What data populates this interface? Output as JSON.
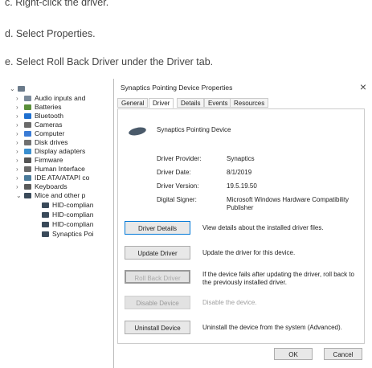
{
  "steps": [
    "c. Right-click the driver.",
    "d. Select Properties.",
    "e. Select Roll Back Driver under the Driver tab."
  ],
  "device_tree": {
    "items": [
      {
        "label": "Audio inputs and",
        "icon": "speaker-icon",
        "color": "#7a8a9a"
      },
      {
        "label": "Batteries",
        "icon": "battery-icon",
        "color": "#5a8f3a"
      },
      {
        "label": "Bluetooth",
        "icon": "bluetooth-icon",
        "color": "#1e6fd0"
      },
      {
        "label": "Cameras",
        "icon": "camera-icon",
        "color": "#6a6a6a"
      },
      {
        "label": "Computer",
        "icon": "computer-icon",
        "color": "#3a7bd5"
      },
      {
        "label": "Disk drives",
        "icon": "disk-icon",
        "color": "#707070"
      },
      {
        "label": "Display adapters",
        "icon": "display-icon",
        "color": "#3a8fcf"
      },
      {
        "label": "Firmware",
        "icon": "firmware-icon",
        "color": "#555555"
      },
      {
        "label": "Human Interface",
        "icon": "hid-icon",
        "color": "#6a6a6a"
      },
      {
        "label": "IDE ATA/ATAPI co",
        "icon": "ide-icon",
        "color": "#4a7a9a"
      },
      {
        "label": "Keyboards",
        "icon": "keyboard-icon",
        "color": "#5a5a5a"
      },
      {
        "label": "Mice and other p",
        "icon": "mouse-icon",
        "color": "#3a4a5a"
      },
      {
        "label": "HID-complian",
        "icon": "mouse-icon",
        "color": "#3a4a5a"
      },
      {
        "label": "HID-complian",
        "icon": "mouse-icon",
        "color": "#3a4a5a"
      },
      {
        "label": "HID-complian",
        "icon": "mouse-icon",
        "color": "#3a4a5a"
      },
      {
        "label": "Synaptics Poi",
        "icon": "mouse-icon",
        "color": "#3a4a5a"
      }
    ]
  },
  "dialog": {
    "title": "Synaptics Pointing Device Properties",
    "close": "×",
    "tabs": [
      "General",
      "Driver",
      "Details",
      "Events",
      "Resources"
    ],
    "active_tab": "Driver",
    "device_name": "Synaptics Pointing Device",
    "properties": [
      {
        "label": "Driver Provider:",
        "value": "Synaptics"
      },
      {
        "label": "Driver Date:",
        "value": "8/1/2019"
      },
      {
        "label": "Driver Version:",
        "value": "19.5.19.50"
      },
      {
        "label": "Digital Signer:",
        "value": "Microsoft Windows Hardware Compatibility Publisher"
      }
    ],
    "actions": [
      {
        "button": "Driver Details",
        "description": "View details about the installed driver files."
      },
      {
        "button": "Update Driver",
        "description": "Update the driver for this device."
      },
      {
        "button": "Roll Back Driver",
        "description": "If the device fails after updating the driver, roll back to the previously installed driver."
      },
      {
        "button": "Disable Device",
        "description": "Disable the device."
      },
      {
        "button": "Uninstall Device",
        "description": "Uninstall the device from the system (Advanced)."
      }
    ],
    "ok": "OK",
    "cancel": "Cancel"
  }
}
